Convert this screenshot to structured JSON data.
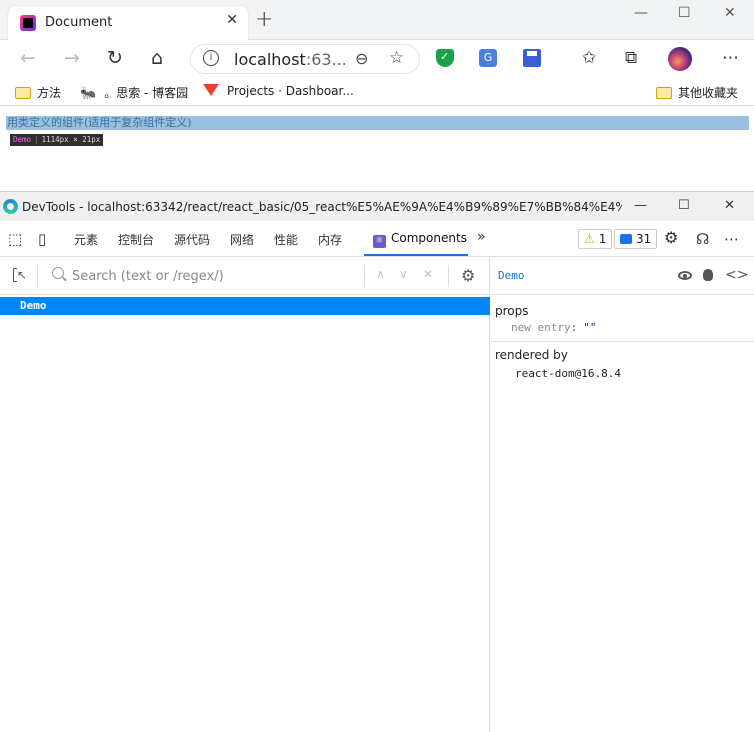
{
  "browser": {
    "tab_title": "Document",
    "tab_close": "✕",
    "new_tab": "+",
    "window_controls": {
      "minimize": "—",
      "maximize": "☐",
      "close": "✕"
    },
    "url_host": "localhost",
    "url_port": ":63...",
    "info_glyph": "i",
    "translate_glyph": "G",
    "bookmarks": [
      {
        "label": "方法",
        "icon": "folder-icon"
      },
      {
        "label": "。思索 - 博客园",
        "icon": "ant-icon"
      },
      {
        "label": "Projects · Dashboar...",
        "icon": "gitlab-icon"
      }
    ],
    "other_bookmarks": "其他收藏夹"
  },
  "page": {
    "text": "用类定义的组件(适用于复杂组件定义)",
    "inspect_tooltip": {
      "name": "Demo",
      "size": "1114px × 21px"
    }
  },
  "devtools": {
    "window_title": "DevTools - localhost:63342/react/react_basic/05_react%E5%AE%9A%E4%B9%89%E7%BB%84%E4%BB%B6/%E...",
    "window_controls": {
      "minimize": "—",
      "maximize": "☐",
      "close": "✕"
    },
    "tabs": [
      "元素",
      "控制台",
      "源代码",
      "网络",
      "性能",
      "内存"
    ],
    "active_tab": "Components",
    "more_tabs": "»",
    "warnings_count": "1",
    "messages_count": "31",
    "more_menu": "⋯",
    "components": {
      "search_placeholder": "Search (text or /regex/)",
      "tree": [
        "Demo"
      ],
      "selected": {
        "name": "Demo",
        "props_title": "props",
        "props": [
          {
            "key": "new entry",
            "value": "\"\""
          }
        ],
        "rendered_by_title": "rendered by",
        "rendered_by": "react-dom@16.8.4"
      }
    }
  }
}
